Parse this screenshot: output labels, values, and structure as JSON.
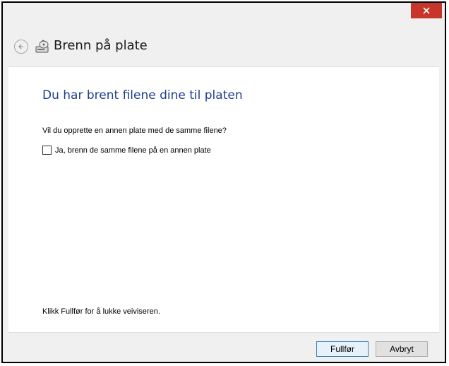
{
  "window": {
    "close_symbol": "×"
  },
  "nav": {
    "back_icon": "back-arrow-icon",
    "app_icon": "disc-burner-icon",
    "title": "Brenn på plate"
  },
  "main": {
    "heading": "Du har brent filene dine til platen",
    "question": "Vil du opprette en annen plate med de samme filene?",
    "checkbox_label": "Ja, brenn de samme filene på en annen plate",
    "checkbox_checked": false,
    "hint": "Klikk Fullfør for å lukke veiviseren."
  },
  "footer": {
    "finish_label": "Fullfør",
    "cancel_label": "Avbryt"
  },
  "colors": {
    "close_button": "#c7352b",
    "heading": "#1e3f8e"
  }
}
